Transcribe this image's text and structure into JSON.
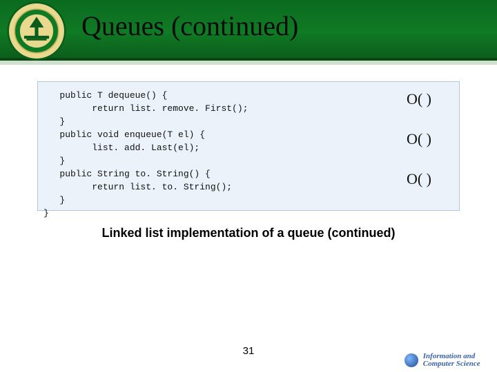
{
  "header": {
    "title": "Queues (continued)"
  },
  "code": {
    "text": "   public T dequeue() {\n         return list. remove. First();\n   }\n   public void enqueue(T el) {\n         list. add. Last(el);\n   }\n   public String to. String() {\n         return list. to. String();\n   }\n}"
  },
  "complexity": {
    "o1": "O(   )",
    "o2": "O(   )",
    "o3": "O(   )"
  },
  "caption": "Linked list implementation of a queue (continued)",
  "page": "31",
  "footer": {
    "line1": "Information and",
    "line2": "Computer Science"
  }
}
